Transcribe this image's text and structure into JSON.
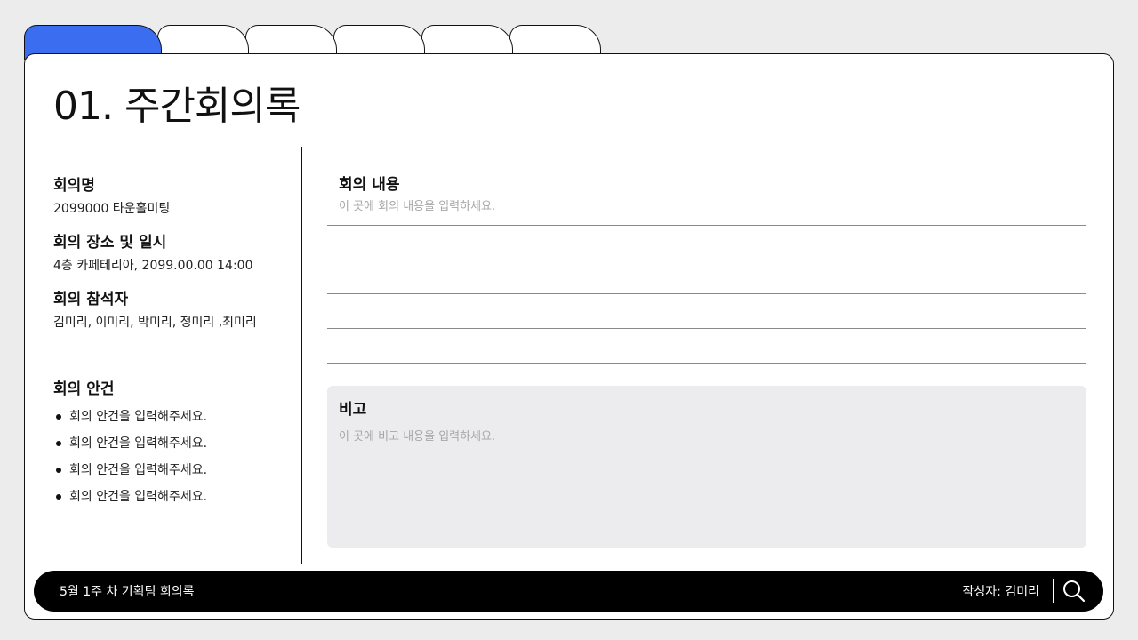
{
  "page_title": "01. 주간회의록",
  "tabs": [
    {
      "label": "",
      "active": true
    },
    {
      "label": "",
      "active": false
    },
    {
      "label": "",
      "active": false
    },
    {
      "label": "",
      "active": false
    },
    {
      "label": "",
      "active": false
    },
    {
      "label": "",
      "active": false
    }
  ],
  "info": {
    "meeting_name_label": "회의명",
    "meeting_name_value": "2099000 타운홀미팅",
    "place_time_label": "회의 장소 및 일시",
    "place_time_value": "4층 카페테리아, 2099.00.00 14:00",
    "attendees_label": "회의 참석자",
    "attendees_value": "김미리, 이미리, 박미리, 정미리 ,최미리"
  },
  "agenda": {
    "label": "회의 안건",
    "items": [
      "회의 안건을 입력해주세요.",
      "회의 안건을 입력해주세요.",
      "회의 안건을 입력해주세요.",
      "회의 안건을 입력해주세요."
    ]
  },
  "content": {
    "label": "회의 내용",
    "placeholder": "이 곳에 회의 내용을 입력하세요."
  },
  "remarks": {
    "label": "비고",
    "placeholder": "이 곳에 비고 내용을 입력하세요."
  },
  "footer": {
    "title": "5월 1주 차 기획팀 회의록",
    "author": "작성자: 김미리"
  },
  "colors": {
    "active_tab": "#3b6df0",
    "background": "#ececed",
    "remark_box": "#ececee",
    "bar": "#000000"
  },
  "icons": {
    "search": "search-icon"
  }
}
